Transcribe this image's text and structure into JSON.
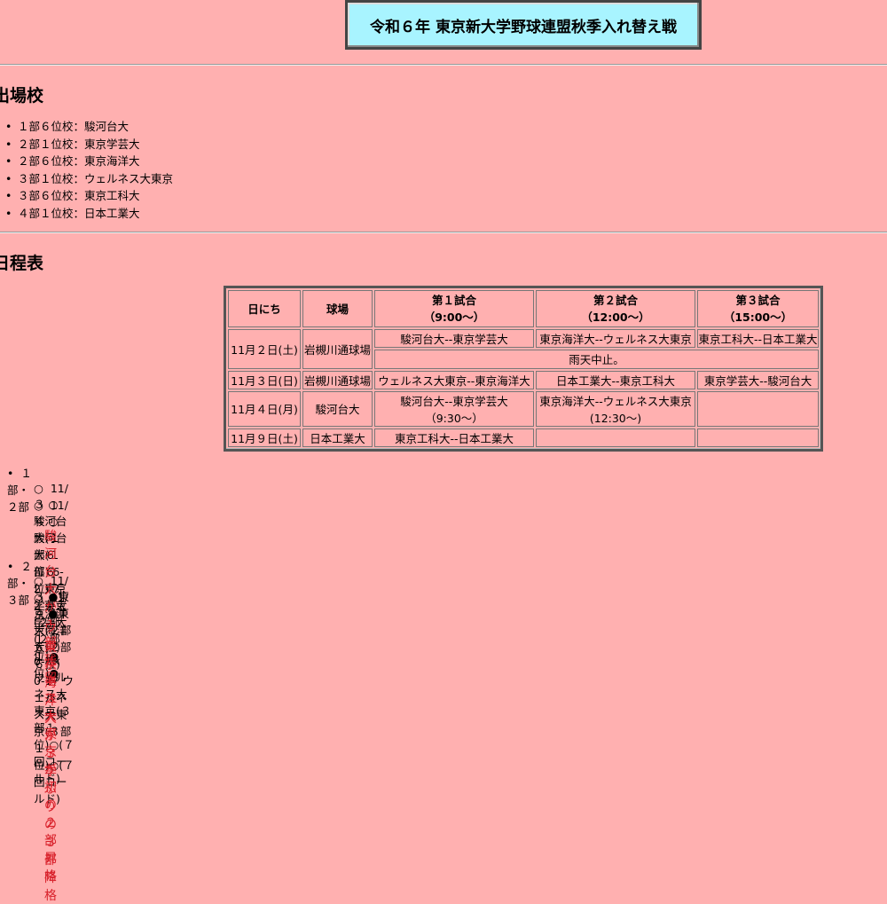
{
  "title": "令和６年 東京新大学野球連盟秋季入れ替え戦",
  "participants": {
    "heading": "出場校",
    "items": [
      "１部６位校：駿河台大",
      "２部１位校：東京学芸大",
      "２部６位校：東京海洋大",
      "３部１位校：ウェルネス大東京",
      "３部６位校：東京工科大",
      "４部１位校：日本工業大"
    ]
  },
  "schedule": {
    "heading": "日程表",
    "headers": {
      "date": "日にち",
      "venue": "球場",
      "g1": "第１試合",
      "g1_time": "（9:00～）",
      "g2": "第２試合",
      "g2_time": "（12:00～）",
      "g3": "第３試合",
      "g3_time": "（15:00～）"
    },
    "rows": {
      "r1_date": "11月２日(土)",
      "r1_venue": "岩槻川通球場",
      "r1_g1": "駿河台大--東京学芸大",
      "r1_g2": "東京海洋大--ウェルネス大東京",
      "r1_g3": "東京工科大--日本工業大",
      "r1_note": "雨天中止。",
      "r2_date": "11月３日(日)",
      "r2_venue": "岩槻川通球場",
      "r2_g1": "ウェルネス大東京--東京海洋大",
      "r2_g2": "日本工業大--東京工科大",
      "r2_g3": "東京学芸大--駿河台大",
      "r3_date": "11月４日(月)",
      "r3_venue": "駿河台大",
      "r3_g1": "駿河台大--東京学芸大",
      "r3_g1_time": "（9:30～）",
      "r3_g2": "東京海洋大--ウェルネス大東京",
      "r3_g2_time": "(12:30～)",
      "r4_date": "11月９日(土)",
      "r4_venue": "日本工業大",
      "r4_g1": "東京工科大--日本工業大"
    }
  },
  "results": {
    "div12": {
      "label": "１部・２部",
      "games": [
        "11/３ ○駿河台大(１部６位) 6-2 東京学芸大(２部１位)●",
        "11/４ ○駿河台大(１部６位) 7-2 東京学芸大(２部１位)●"
      ],
      "outcome": "駿河台大が１部残留"
    },
    "div23": {
      "label": "２部・３部",
      "games": [
        "11/３ ●東京海洋大(２部６位) 0-7× ウェルネス大東京(３部１位)○(７回コールド)",
        "11/４ ●東京海洋大(２部６位) 0-17 ウェルネス大東京(３部１位)○(７回コールド)"
      ],
      "outcome1": "ウェルネス大東京が初の２部昇格",
      "outcome2": "東京海洋大が３季ぶりの３部降格"
    }
  }
}
